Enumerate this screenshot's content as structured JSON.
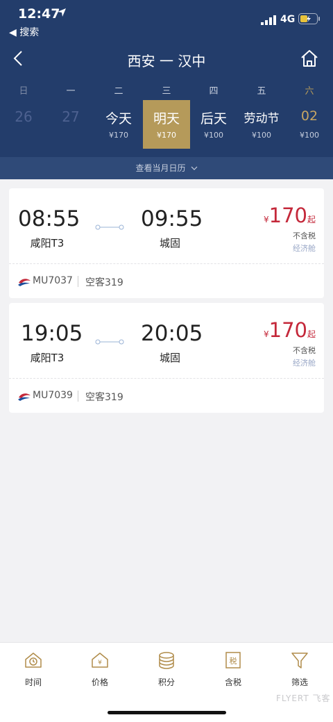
{
  "status_bar": {
    "time": "12:47",
    "back_app": "◀ 搜索",
    "network": "4G"
  },
  "header": {
    "title": "西安 一 汉中"
  },
  "weekdays": [
    "日",
    "一",
    "二",
    "三",
    "四",
    "五",
    "六"
  ],
  "dates": [
    {
      "label": "26",
      "price": ""
    },
    {
      "label": "27",
      "price": ""
    },
    {
      "label": "今天",
      "price": "¥170"
    },
    {
      "label": "明天",
      "price": "¥170"
    },
    {
      "label": "后天",
      "price": "¥100"
    },
    {
      "label": "劳动节",
      "price": "¥100"
    },
    {
      "label": "02",
      "price": "¥100"
    }
  ],
  "calendar_link": "查看当月日历",
  "flights": [
    {
      "dep_time": "08:55",
      "dep_airport": "咸阳T3",
      "arr_time": "09:55",
      "arr_airport": "城固",
      "currency": "¥",
      "price": "170",
      "price_suffix": "起",
      "tax_note": "不含税",
      "cabin": "经济舱",
      "flight_no": "MU7037",
      "aircraft": "空客319"
    },
    {
      "dep_time": "19:05",
      "dep_airport": "咸阳T3",
      "arr_time": "20:05",
      "arr_airport": "城固",
      "currency": "¥",
      "price": "170",
      "price_suffix": "起",
      "tax_note": "不含税",
      "cabin": "经济舱",
      "flight_no": "MU7039",
      "aircraft": "空客319"
    }
  ],
  "tabs": [
    {
      "label": "时间",
      "icon": "clock-icon"
    },
    {
      "label": "价格",
      "icon": "price-icon"
    },
    {
      "label": "积分",
      "icon": "coins-icon"
    },
    {
      "label": "含税",
      "icon": "tax-icon"
    },
    {
      "label": "筛选",
      "icon": "filter-icon"
    }
  ],
  "watermark": "FLYERT 飞客",
  "colors": {
    "header": "#233d6b",
    "accent_gold": "#b59a5a",
    "price_red": "#c4283a"
  }
}
